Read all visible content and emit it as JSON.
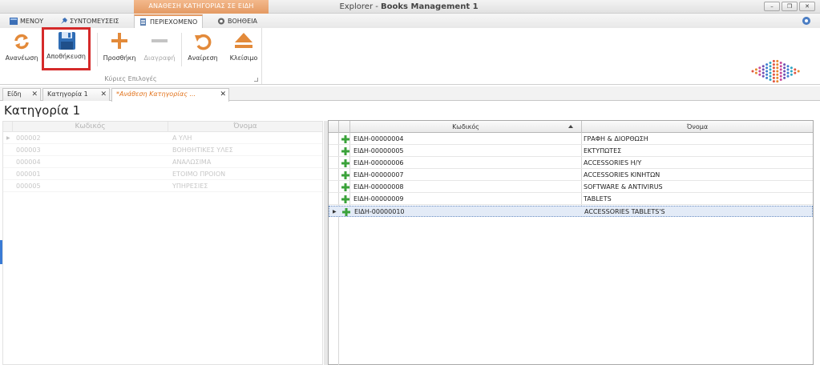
{
  "window": {
    "context_label": "ΑΝΑΘΕΣΗ ΚΑΤΗΓΟΡΙΑΣ ΣΕ ΕΙΔΗ",
    "title_prefix": "Explorer - ",
    "title_app": "Books Management 1",
    "min_label": "–",
    "restore_label": "❐",
    "close_label": "✕"
  },
  "ribbon_tabs": [
    {
      "label": "ΜΕΝΟΥ"
    },
    {
      "label": "ΣΥΝΤΟΜΕΥΣΕΙΣ"
    },
    {
      "label": "ΠΕΡΙΕΧΟΜΕΝΟ"
    },
    {
      "label": "ΒΟΗΘΕΙΑ"
    }
  ],
  "ribbon": {
    "group_label": "Κύριες Επιλογές",
    "buttons": [
      {
        "label": "Ανανέωση",
        "icon": "refresh-icon"
      },
      {
        "label": "Αποθήκευση",
        "icon": "save-icon"
      },
      {
        "label": "Προσθήκη",
        "icon": "plus-icon"
      },
      {
        "label": "Διαγραφή",
        "icon": "minus-icon"
      },
      {
        "label": "Αναίρεση",
        "icon": "undo-icon"
      },
      {
        "label": "Κλείσιμο",
        "icon": "eject-icon"
      }
    ]
  },
  "doc_tabs": [
    {
      "label": "Είδη"
    },
    {
      "label": "Κατηγορία 1"
    },
    {
      "label": "*Ανάθεση Κατηγορίας ..."
    }
  ],
  "page_title": "Κατηγορία 1",
  "left_grid": {
    "columns": [
      "Κωδικός",
      "Όνομα"
    ],
    "rows": [
      {
        "code": "000002",
        "name": "Α ΥΛΗ"
      },
      {
        "code": "000003",
        "name": "ΒΟΗΘΗΤΙΚΕΣ ΥΛΕΣ"
      },
      {
        "code": "000004",
        "name": "ΑΝΑΛΩΣΙΜΑ"
      },
      {
        "code": "000001",
        "name": "ΕΤΟΙΜΟ ΠΡΟΙΟΝ"
      },
      {
        "code": "000005",
        "name": "ΥΠΗΡΕΣΙΕΣ"
      }
    ]
  },
  "right_grid": {
    "columns": [
      "Κωδικός",
      "Όνομα"
    ],
    "rows": [
      {
        "code": "ΕΙΔΗ-00000004",
        "name": "ΓΡΑΦΗ & ΔΙΟΡΘΩΣΗ"
      },
      {
        "code": "ΕΙΔΗ-00000005",
        "name": "ΕΚΤΥΠΩΤΕΣ"
      },
      {
        "code": "ΕΙΔΗ-00000006",
        "name": "ACCESSORIES Η/Υ"
      },
      {
        "code": "ΕΙΔΗ-00000007",
        "name": "ACCESSORIES ΚΙΝΗΤΩΝ"
      },
      {
        "code": "ΕΙΔΗ-00000008",
        "name": "SOFTWARE & ANTIVIRUS"
      },
      {
        "code": "ΕΙΔΗ-00000009",
        "name": "TABLETS"
      },
      {
        "code": "ΕΙΔΗ-00000010",
        "name": "ACCESSORIES TABLETS'S"
      }
    ],
    "selected_index": 6
  },
  "colors": {
    "accent_orange": "#e49a63",
    "highlight_red": "#d52a2a",
    "active_tab_text": "#e2731c",
    "save_blue": "#2f6db5"
  }
}
